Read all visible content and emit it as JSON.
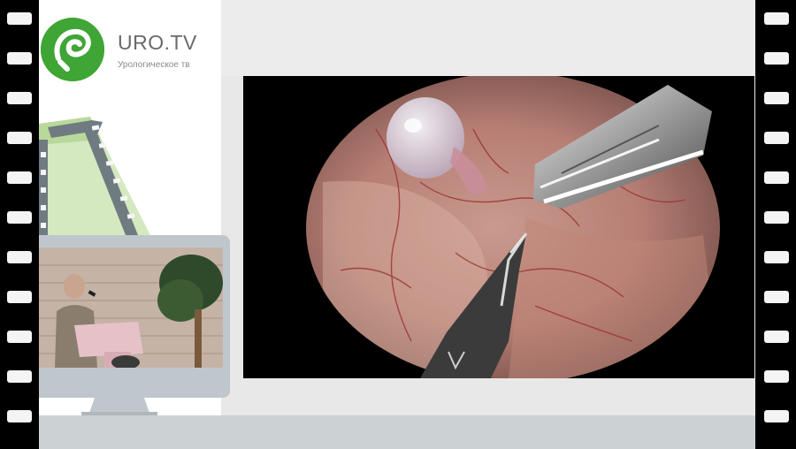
{
  "brand": {
    "title": "URO.TV",
    "subtitle": "Урологическое тв",
    "accent_color": "#3fa535"
  },
  "icons": {
    "logo": "uro-tv-logo-icon",
    "film": "film-strip-icon",
    "monitor": "monitor-icon"
  },
  "media": {
    "main_video": "laparoscopic-surgery-video",
    "speaker_inset": "speaker-at-podium-video"
  }
}
